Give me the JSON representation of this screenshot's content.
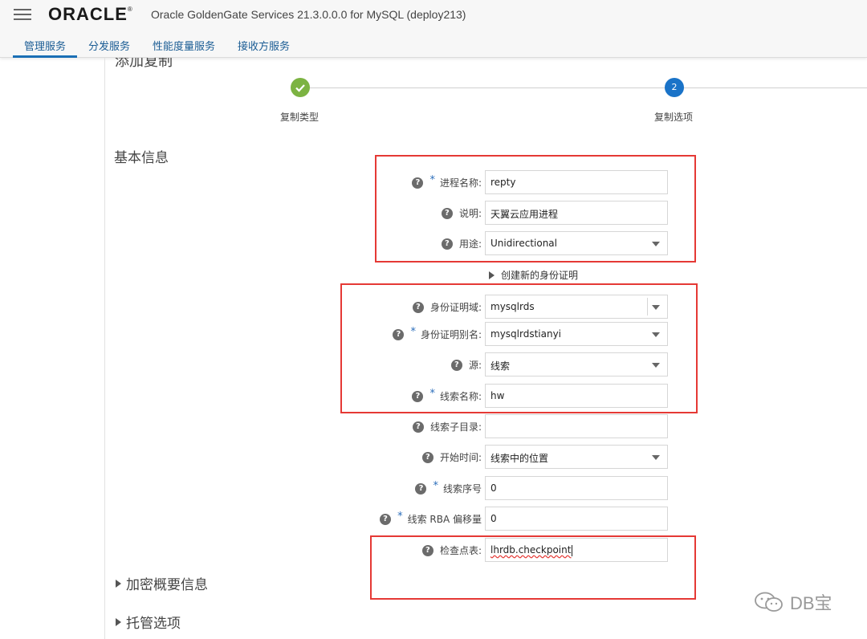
{
  "header": {
    "logo": "ORACLE",
    "app_title": "Oracle GoldenGate Services 21.3.0.0.0 for MySQL (deploy213)",
    "tabs": [
      {
        "label": "管理服务",
        "active": true
      },
      {
        "label": "分发服务"
      },
      {
        "label": "性能度量服务"
      },
      {
        "label": "接收方服务"
      }
    ]
  },
  "page": {
    "title": "添加复制",
    "steps": [
      {
        "label": "复制类型",
        "state": "done"
      },
      {
        "label": "复制选项",
        "number": "2",
        "state": "current"
      }
    ],
    "section_basic": "基本信息",
    "create_credential": "创建新的身份证明",
    "section_encryption": "加密概要信息",
    "section_managed": "托管选项"
  },
  "form": {
    "process_name": {
      "label": "进程名称:",
      "value": "repty",
      "required": true
    },
    "description": {
      "label": "说明:",
      "value": "天翼云应用进程"
    },
    "purpose": {
      "label": "用途:",
      "value": "Unidirectional"
    },
    "credential_domain": {
      "label": "身份证明域:",
      "value": "mysqlrds"
    },
    "credential_alias": {
      "label": "身份证明别名:",
      "value": "mysqlrdstianyi",
      "required": true
    },
    "source": {
      "label": "源:",
      "value": "线索"
    },
    "trail_name": {
      "label": "线索名称:",
      "value": "hw",
      "required": true
    },
    "trail_subdir": {
      "label": "线索子目录:",
      "value": ""
    },
    "start_time": {
      "label": "开始时间:",
      "value": "线索中的位置"
    },
    "trail_seq": {
      "label": "线索序号",
      "value": "0",
      "required": true
    },
    "trail_rba": {
      "label": "线索 RBA 偏移量",
      "value": "0",
      "required": true
    },
    "checkpoint_table": {
      "label": "检查点表:",
      "value": "lhrdb.checkpoint"
    }
  },
  "watermark": "DB宝",
  "colors": {
    "annotation": "#e53935",
    "accent": "#1a73c8",
    "done": "#7cb342"
  }
}
